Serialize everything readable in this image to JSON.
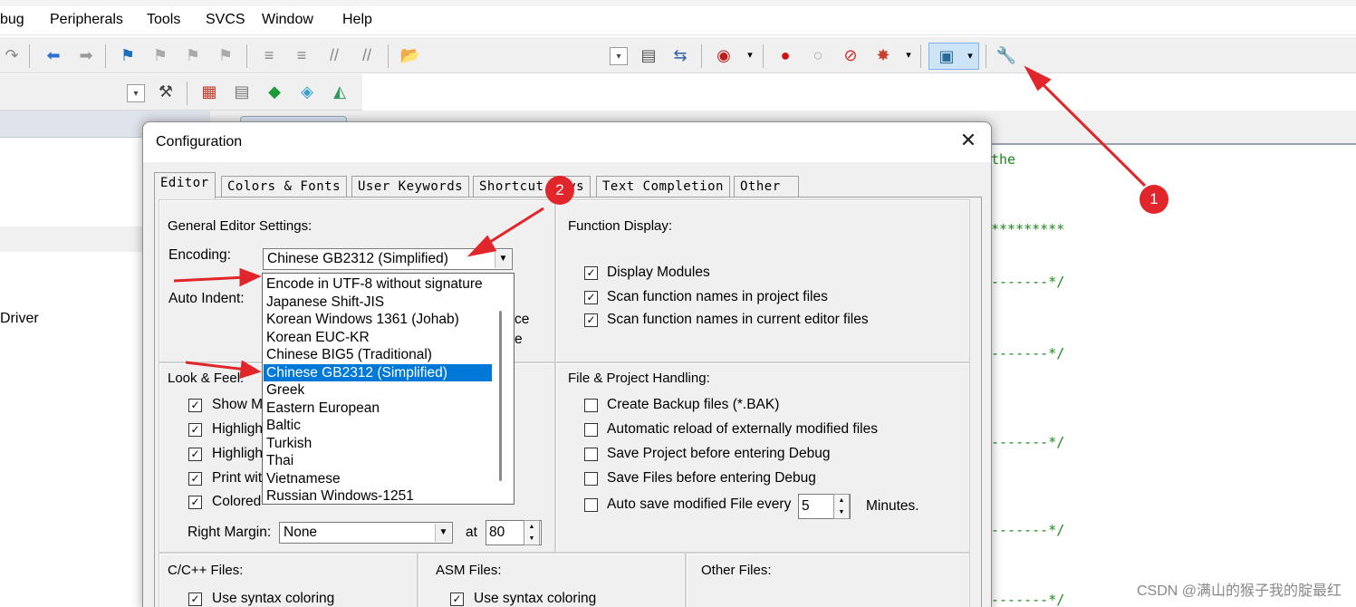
{
  "menubar": {
    "items": [
      "bug",
      "Peripherals",
      "Tools",
      "SVCS",
      "Window",
      "Help"
    ]
  },
  "left_panel": {
    "driver_label": "Driver"
  },
  "code": {
    "lines": [
      "the",
      "*********",
      "-------*/",
      "-------*/",
      "-------*/",
      "-------*/",
      "-------*/"
    ]
  },
  "dialog": {
    "title": "Configuration",
    "close_glyph": "✕",
    "tabs": [
      "Editor",
      "Colors & Fonts",
      "User Keywords",
      "Shortcut Keys",
      "Text Completion",
      "Other"
    ],
    "general": {
      "heading": "General Editor Settings:",
      "encoding_label": "Encoding:",
      "encoding_value": "Chinese GB2312 (Simplified)",
      "auto_indent_label": "Auto Indent:",
      "partial_a": "ce",
      "partial_b": "e"
    },
    "encoding_options": [
      "Encode in UTF-8 without signature",
      "Japanese Shift-JIS",
      "Korean Windows 1361 (Johab)",
      "Korean EUC-KR",
      "Chinese BIG5 (Traditional)",
      "Chinese GB2312 (Simplified)",
      "Greek",
      "Eastern European",
      "Baltic",
      "Turkish",
      "Thai",
      "Vietnamese",
      "Russian Windows-1251"
    ],
    "selected_option_index": 5,
    "function_display": {
      "heading": "Function Display:",
      "items": [
        {
          "label": "Display Modules",
          "checked": true
        },
        {
          "label": "Scan function names in project files",
          "checked": true
        },
        {
          "label": "Scan function names in current editor files",
          "checked": true
        }
      ]
    },
    "look_feel": {
      "heading": "Look & Feel:",
      "items": [
        "Show M",
        "Highligh",
        "Highligh",
        "Print wit",
        "Colored"
      ],
      "right_margin_label": "Right Margin:",
      "right_margin_value": "None",
      "at_label": "at",
      "at_value": "80"
    },
    "file_project": {
      "heading": "File & Project Handling:",
      "items": [
        {
          "label": "Create Backup files (*.BAK)",
          "checked": false
        },
        {
          "label": "Automatic reload of externally modified files",
          "checked": false
        },
        {
          "label": "Save Project before entering Debug",
          "checked": false
        },
        {
          "label": "Save Files before entering Debug",
          "checked": false
        },
        {
          "label": "Auto save modified File every",
          "checked": false
        }
      ],
      "autosave_value": "5",
      "minutes_label": "Minutes."
    },
    "cpp_files": {
      "heading": "C/C++ Files:",
      "syntax": "Use syntax coloring"
    },
    "asm_files": {
      "heading": "ASM Files:",
      "syntax": "Use syntax coloring"
    },
    "other_files": {
      "heading": "Other Files:"
    }
  },
  "annotations": {
    "badge1": "1",
    "badge2": "2",
    "color": "#e0262a"
  },
  "watermark": "CSDN @满山的猴子我的腚最红"
}
